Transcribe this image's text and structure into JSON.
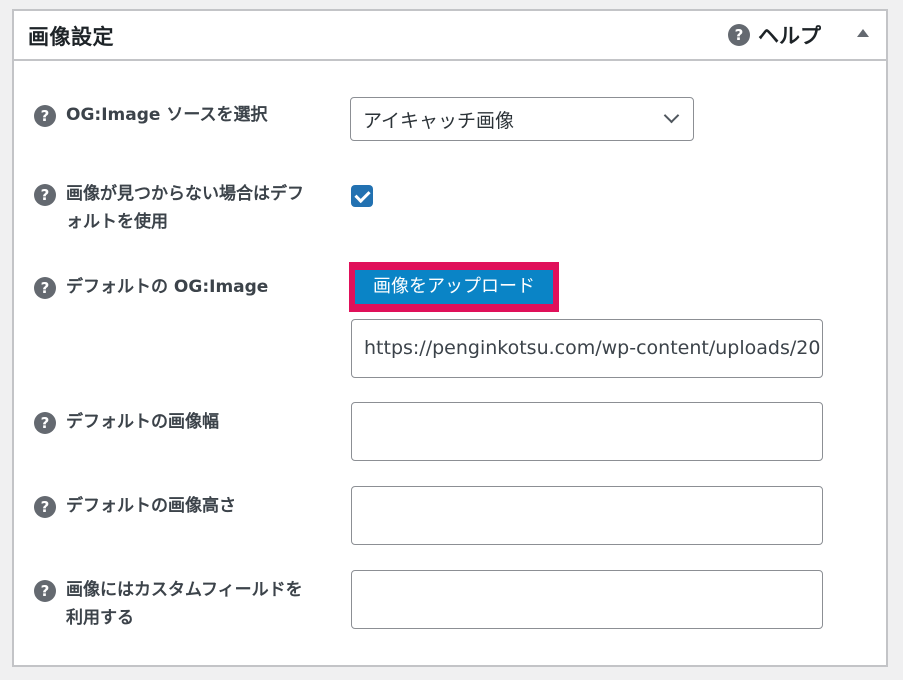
{
  "panel": {
    "title": "画像設定",
    "help_label": "ヘルプ",
    "help_icon": "?",
    "collapse_icon": "triangle-up-icon"
  },
  "rows": [
    {
      "label": "OG:Image ソースを選択"
    },
    {
      "label": "画像が見つからない場合はデフォルトを使用"
    },
    {
      "label": "デフォルトの OG:Image"
    },
    {
      "label": "デフォルトの画像幅"
    },
    {
      "label": "デフォルトの画像高さ"
    },
    {
      "label": "画像にはカスタムフィールドを利用する"
    }
  ],
  "source_select": {
    "value": "アイキャッチ画像"
  },
  "use_default_checkbox": {
    "checked": true
  },
  "upload_button": {
    "label": "画像をアップロード",
    "highlight_color": "#e0105a"
  },
  "default_image_url": {
    "value": "https://penginkotsu.com/wp-content/uploads/20"
  },
  "default_width": {
    "value": ""
  },
  "default_height": {
    "value": ""
  },
  "custom_field": {
    "value": ""
  },
  "colors": {
    "accent": "#2271b1",
    "upload_button": "#0a84c6",
    "help_icon": "#646970"
  }
}
